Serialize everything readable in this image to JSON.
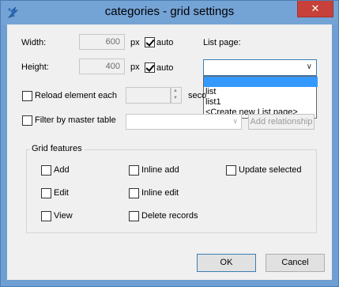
{
  "window": {
    "title": "categories - grid settings",
    "close_label": "✕"
  },
  "size": {
    "width_label": "Width:",
    "width_value": "600",
    "width_unit": "px",
    "width_auto_label": "auto",
    "width_auto_checked": true,
    "height_label": "Height:",
    "height_value": "400",
    "height_unit": "px",
    "height_auto_label": "auto",
    "height_auto_checked": true
  },
  "list_page": {
    "label": "List page:",
    "selected": "",
    "options": [
      "",
      "list",
      "list1",
      "<Create new List page>"
    ]
  },
  "reload": {
    "label": "Reload element each",
    "checked": false,
    "value": "",
    "unit": "seconds"
  },
  "filter": {
    "label": "Filter by master table",
    "checked": false,
    "value": "",
    "add_relationship_label": "Add relationship"
  },
  "grid_features": {
    "title": "Grid features",
    "add": {
      "label": "Add",
      "checked": false
    },
    "edit": {
      "label": "Edit",
      "checked": false
    },
    "view": {
      "label": "View",
      "checked": false
    },
    "inline_add": {
      "label": "Inline add",
      "checked": false
    },
    "inline_edit": {
      "label": "Inline edit",
      "checked": false
    },
    "delete_records": {
      "label": "Delete records",
      "checked": false
    },
    "update_selected": {
      "label": "Update selected",
      "checked": false
    }
  },
  "buttons": {
    "ok": "OK",
    "cancel": "Cancel"
  },
  "colors": {
    "titlebar": "#74a3d6",
    "close": "#c7413a",
    "highlight": "#3399ff"
  }
}
